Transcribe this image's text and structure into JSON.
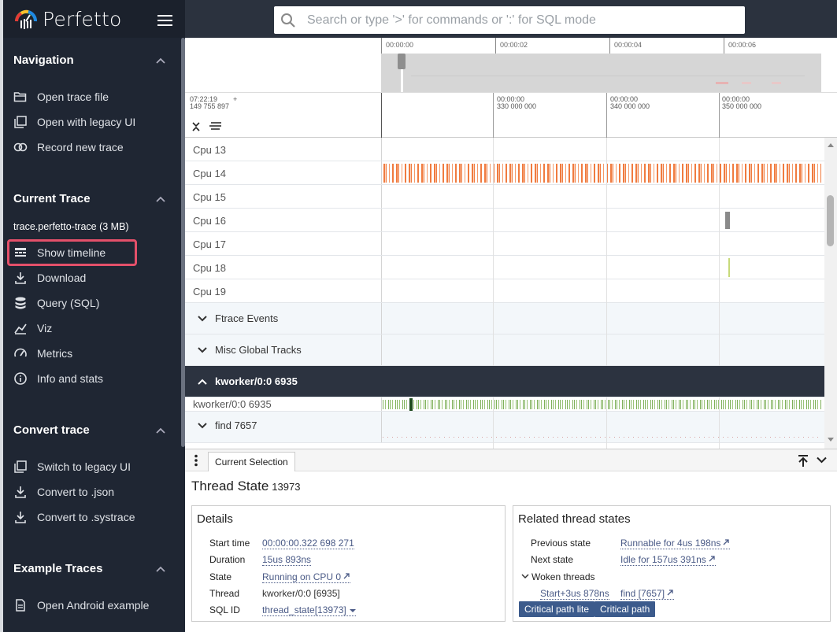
{
  "app": {
    "name": "Perfetto"
  },
  "search": {
    "placeholder": "Search or type '>' for commands or ':' for SQL mode"
  },
  "sidebar": {
    "navigation": {
      "title": "Navigation",
      "items": [
        {
          "label": "Open trace file",
          "icon": "folder-open-icon"
        },
        {
          "label": "Open with legacy UI",
          "icon": "filter-none-icon"
        },
        {
          "label": "Record new trace",
          "icon": "record-icon"
        }
      ]
    },
    "current_trace": {
      "title": "Current Trace",
      "trace_name": "trace.perfetto-trace (3 MB)",
      "items": [
        {
          "label": "Show timeline",
          "icon": "timeline-icon"
        },
        {
          "label": "Download",
          "icon": "download-icon"
        },
        {
          "label": "Query (SQL)",
          "icon": "database-icon"
        },
        {
          "label": "Viz",
          "icon": "chart-icon"
        },
        {
          "label": "Metrics",
          "icon": "speed-icon"
        },
        {
          "label": "Info and stats",
          "icon": "info-icon"
        }
      ]
    },
    "convert_trace": {
      "title": "Convert trace",
      "items": [
        {
          "label": "Switch to legacy UI",
          "icon": "filter-none-icon"
        },
        {
          "label": "Convert to .json",
          "icon": "download-icon"
        },
        {
          "label": "Convert to .systrace",
          "icon": "download-icon"
        }
      ]
    },
    "example_traces": {
      "title": "Example Traces",
      "items": [
        {
          "label": "Open Android example",
          "icon": "description-icon"
        }
      ]
    }
  },
  "timeline": {
    "overview_ticks": [
      "00:00:00",
      "00:00:02",
      "00:00:04",
      "00:00:06"
    ],
    "ruler": {
      "origin_time": "07:22:19",
      "origin_ns": "149 755 897",
      "origin_plus": "+",
      "ticks": [
        {
          "time": "00:00:00",
          "ns": "330 000 000"
        },
        {
          "time": "00:00:00",
          "ns": "340 000 000"
        },
        {
          "time": "00:00:00",
          "ns": "350 000 000"
        }
      ]
    },
    "tracks": {
      "cpu13": "Cpu 13",
      "cpu14": "Cpu 14",
      "cpu15": "Cpu 15",
      "cpu16": "Cpu 16",
      "cpu17": "Cpu 17",
      "cpu18": "Cpu 18",
      "cpu19": "Cpu 19",
      "ftrace": "Ftrace Events",
      "misc": "Misc Global Tracks",
      "kworker_group": "kworker/0:0 6935",
      "kworker_track": "kworker/0:0 6935",
      "find": "find 7657"
    },
    "colors": {
      "cpu14": "#f07b3f",
      "cpu16": "#8a8a8a",
      "cpu18": "#c7d97a",
      "kworker": "#7fb15a",
      "kworker_dark": "#1d4a1d"
    }
  },
  "panel": {
    "tab": "Current Selection",
    "title": "Thread State",
    "title_id": "13973",
    "details": {
      "heading": "Details",
      "rows": [
        {
          "key": "Start time",
          "value": "00:00:00.322 698 271"
        },
        {
          "key": "Duration",
          "value": "15us 893ns"
        },
        {
          "key": "State",
          "value": "Running on CPU 0"
        },
        {
          "key": "Thread",
          "value": "kworker/0:0 [6935]"
        },
        {
          "key": "SQL ID",
          "value": "thread_state[13973]"
        }
      ]
    },
    "related": {
      "heading": "Related thread states",
      "previous_label": "Previous state",
      "previous_value": "Runnable for 4us 198ns",
      "next_label": "Next state",
      "next_value": "Idle for 157us 391ns",
      "woken_label": "Woken threads",
      "woken_time": "Start+3us 878ns",
      "woken_value": "find [7657]",
      "btn_lite": "Critical path lite",
      "btn_full": "Critical path"
    }
  }
}
